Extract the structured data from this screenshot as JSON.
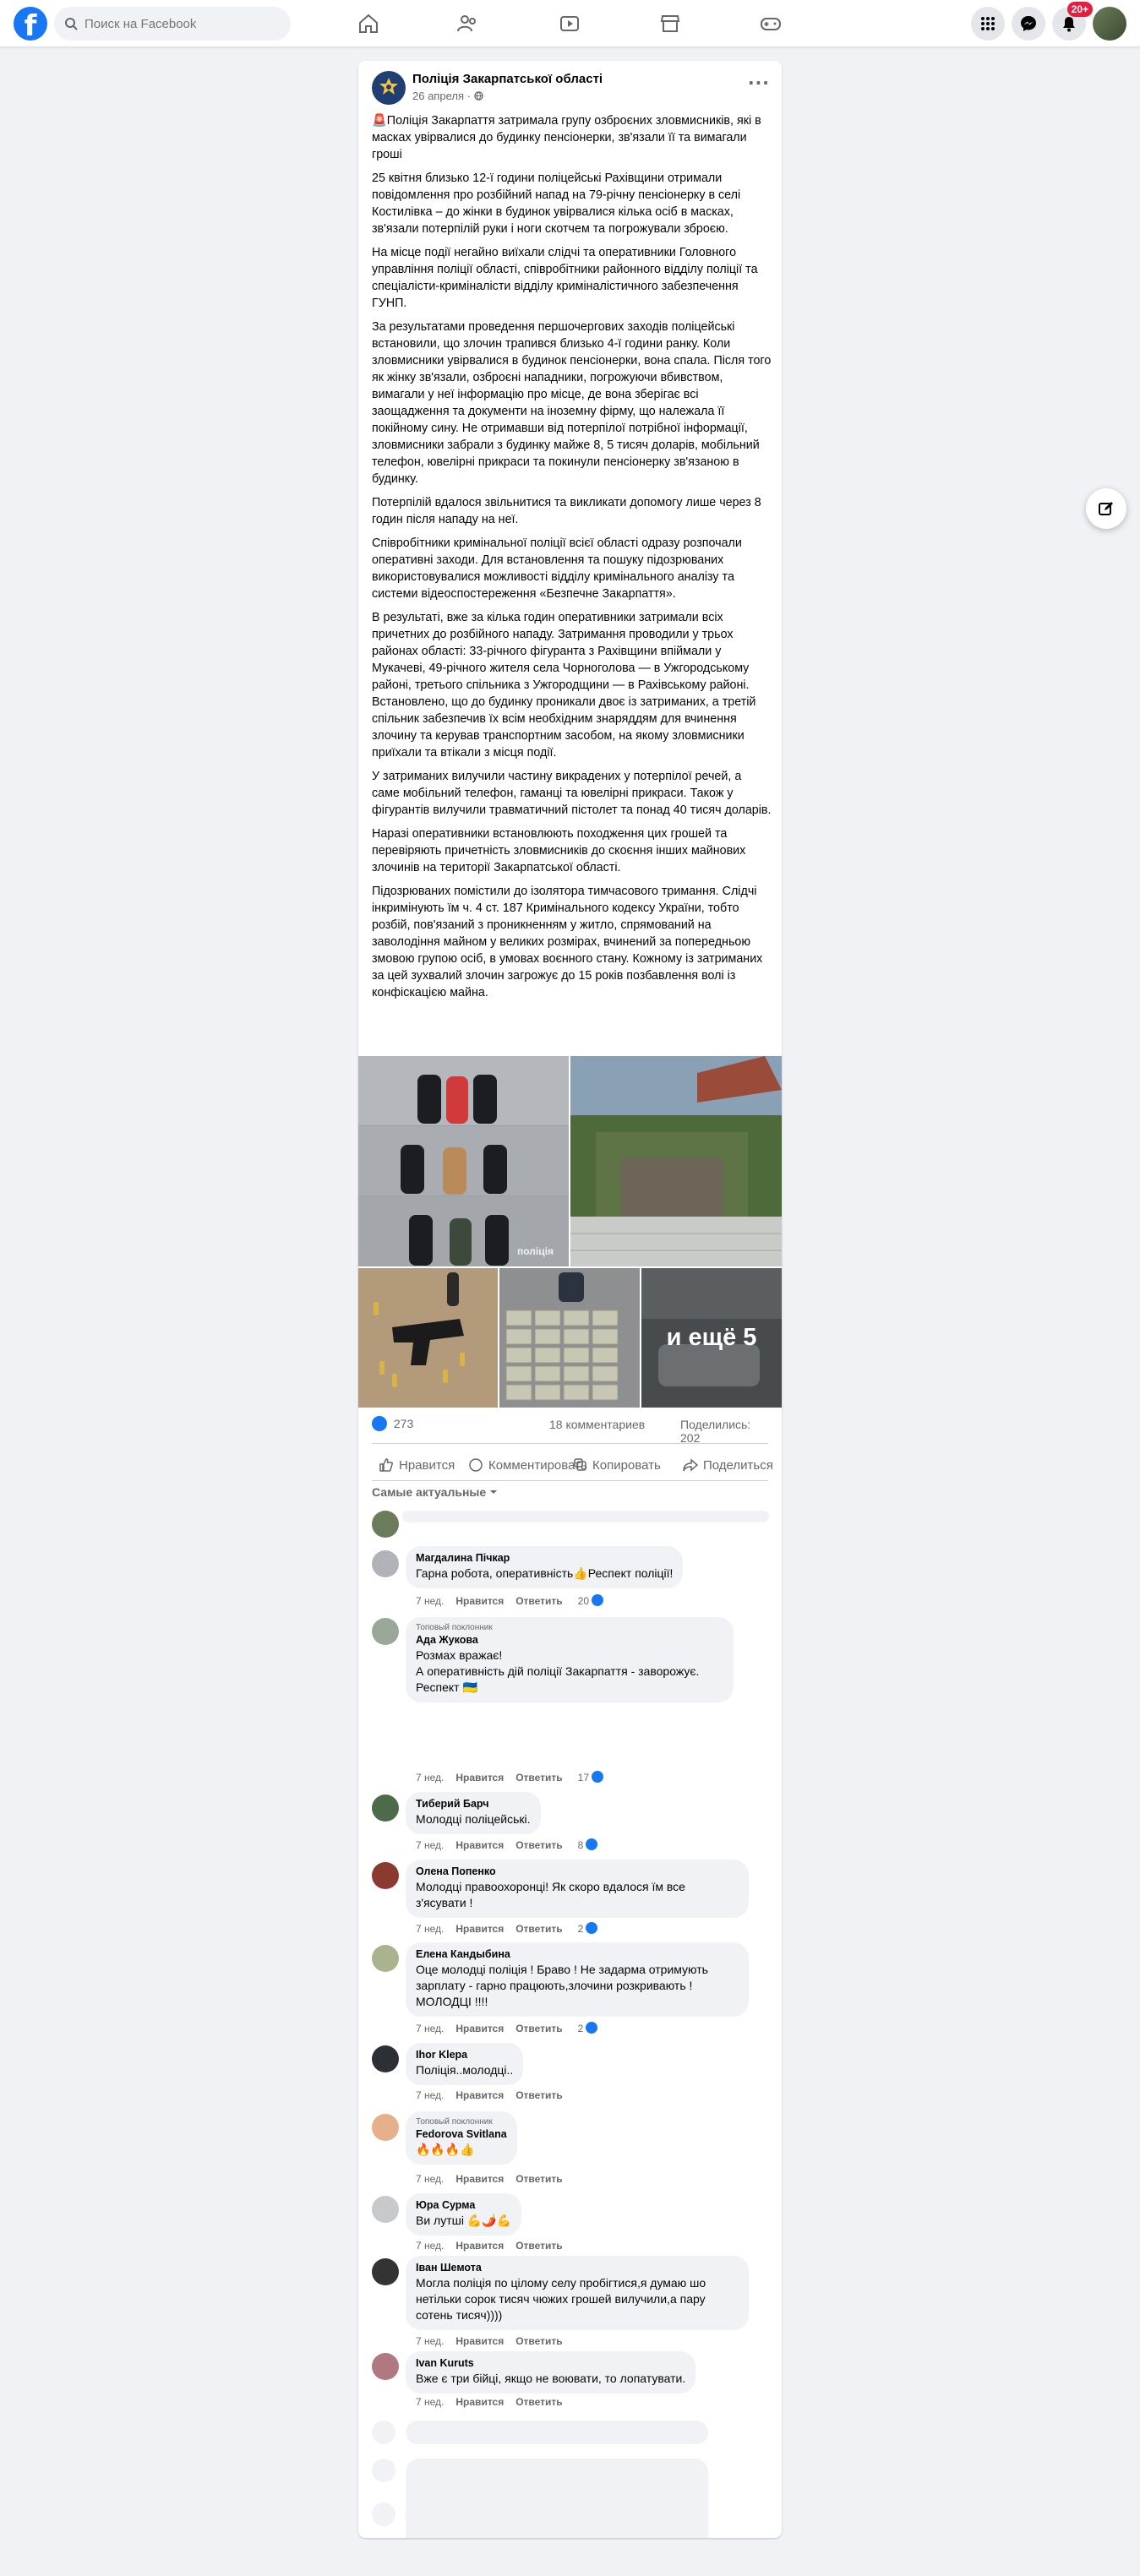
{
  "topbar": {
    "search_placeholder": "Поиск на Facebook",
    "notif_badge": "20+"
  },
  "post": {
    "author": "Поліція Закарпатської області",
    "date": "26 апреля",
    "paragraphs": [
      "🚨Поліція Закарпаття затримала групу озброєних зловмисників, які в масках увірвалися до будинку пенсіонерки, зв'язали її та вимагали гроші",
      "25 квітня близько 12-ї години поліцейські Рахівщини отримали повідомлення про розбійний напад на 79-річну пенсіонерку в селі Костилівка – до жінки в будинок увірвалися кілька осіб в масках, зв'язали потерпілій руки і ноги скотчем та погрожували зброєю.",
      "На місце події негайно виїхали слідчі та оперативники Головного управління поліції області, співробітники районного відділу поліції та спеціалісти-криміналісти відділу криміналістичного забезпечення ГУНП.",
      "За результатами проведення першочергових заходів поліцейські встановили, що злочин трапився близько 4-ї години ранку. Коли зловмисники увірвалися в будинок пенсіонерки, вона спала. Після того як жінку зв'язали, озброєні нападники, погрожуючи вбивством, вимагали у неї інформацію про місце, де вона зберігає всі заощадження та документи на іноземну фірму, що належала її покійному сину. Не отримавши від потерпілої потрібної інформації, зловмисники забрали з будинку майже 8, 5 тисяч доларів, мобільний телефон, ювелірні прикраси та покинули пенсіонерку зв'язаною в будинку.",
      "Потерпілій вдалося звільнитися та викликати допомогу лише через 8 годин після нападу на неї.",
      "Співробітники кримінальної поліції всієї області одразу розпочали оперативні заходи. Для встановлення та пошуку підозрюваних використовувалися можливості відділу кримінального аналізу та системи відеоспостереження «Безпечне Закарпаття».",
      "В результаті, вже за кілька годин оперативники затримали всіх причетних до розбійного нападу. Затримання проводили у трьох районах області: 33-річного фігуранта з Рахівщини впіймали у Мукачеві, 49-річного жителя села Чорноголова — в Ужгородському районі, третього спільника з Ужгородщини — в Рахівському районі. Встановлено, що до будинку проникали двоє із затриманих, а третій спільник забезпечив їх всім необхідним знаряддям для вчинення злочину та керував транспортним засобом, на якому зловмисники приїхали та втікали з місця події.",
      "У затриманих вилучили частину викрадених у потерпілої речей, а саме  мобільний телефон, гаманці та ювелірні прикраси. Також у фігурантів вилучили травматичний пістолет та понад 40 тисяч доларів.",
      "Наразі оперативники встановлюють походження цих грошей та перевіряють причетність зловмисників до скоєння інших майнових злочинів на території Закарпатської області.",
      "Підозрюваних помістили до ізолятора тимчасового тримання. Слідчі інкримінують  їм ч. 4 ст. 187 Кримінального кодексу України, тобто розбій, пов'язаний з проникненням у житло, спрямований на заволодіння майном у великих розмірах, вчинений за попередньою змовою групою осіб, в умовах воєнного стану. Кожному із затриманих за цей зухвалий злочин загрожує до 15 років позбавлення волі із конфіскацією майна."
    ],
    "photo_watermark": "поліція",
    "more_photos": "и ещё 5"
  },
  "stats": {
    "reactions": "273",
    "comments": "18 комментариев",
    "shares": "Поделились: 202"
  },
  "actions": {
    "like": "Нравится",
    "comment": "Комментировать",
    "copy": "Копировать",
    "share": "Поделиться"
  },
  "sort_label": "Самые актуальные",
  "comment_labels": {
    "time": "7 нед.",
    "like": "Нравится",
    "reply": "Ответить",
    "top_fan": "Топовый поклонник"
  },
  "comments": [
    {
      "name": "Магдалина Пічкар",
      "text": "Гарна робота, оперативність👍Респект поліції!",
      "likes": "20"
    },
    {
      "name": "Ада Жукова",
      "text": "Розмах вражає!\nА оперативність дій поліції Закарпаття - заворожує.\nРеспект 🇺🇦",
      "likes": "17"
    },
    {
      "name": "Тиберий Барч",
      "text": "Молодці поліцейські.",
      "likes": "8"
    },
    {
      "name": "Олена Попенко",
      "text": "Молодці правоохоронці! Як скоро вдалося їм все з'ясувати !",
      "likes": "2"
    },
    {
      "name": "Елена Кандыбина",
      "text": "Оце молодці поліція ! Браво ! Не задарма отримують зарплату - гарно працюють,злочини розкривають ! МОЛОДЦІ !!!!",
      "likes": "2"
    },
    {
      "name": "Ihor Klepa",
      "text": "Поліція..молодці..",
      "likes": ""
    },
    {
      "name": "Fedorova Svitlana",
      "text": "🔥🔥🔥👍",
      "likes": ""
    },
    {
      "name": "Юра Сурма",
      "text": "Ви лутші 💪🌶️💪",
      "likes": ""
    },
    {
      "name": "Іван Шемота",
      "text": "Могла поліція по цілому селу пробігтися,я думаю шо нетільки сорок тисяч чюжих грошей вилучили,а пару сотень тисяч))))",
      "likes": ""
    },
    {
      "name": "Ivan Kuruts",
      "text": "Вже є три бійці, якщо не воювати, то лопатувати.",
      "likes": ""
    }
  ]
}
